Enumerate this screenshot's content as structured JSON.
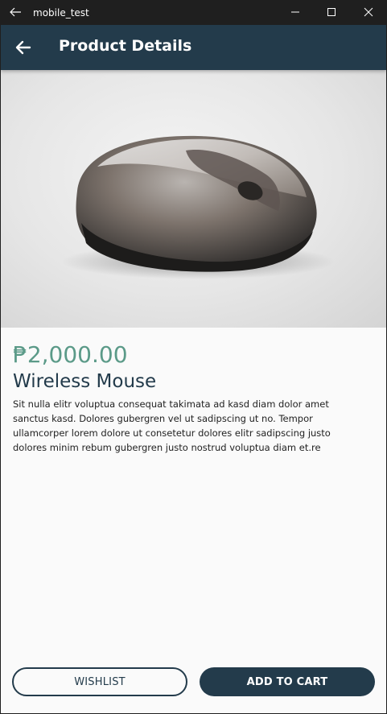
{
  "window": {
    "title": "mobile_test",
    "icons": [
      "back-arrow-icon",
      "minimize-icon",
      "maximize-icon",
      "close-icon"
    ]
  },
  "appbar": {
    "title": "Product Details",
    "background": "#233b4b",
    "nav_icon": "arrow-left-icon"
  },
  "product": {
    "image": "wireless-mouse-photo",
    "price": "₱2,000.00",
    "name": "Wireless Mouse",
    "description": "Sit nulla elitr voluptua consequat takimata ad kasd diam dolor amet sanctus kasd. Dolores gubergren vel ut sadipscing ut no. Tempor ullamcorper lorem dolore ut consetetur dolores elitr sadipscing justo dolores minim rebum gubergren justo nostrud voluptua diam et.re"
  },
  "actions": {
    "wishlist_label": "WISHLIST",
    "add_to_cart_label": "ADD TO CART"
  },
  "colors": {
    "primary": "#233b4b",
    "price": "#5b9a88",
    "background": "#fafafa"
  }
}
